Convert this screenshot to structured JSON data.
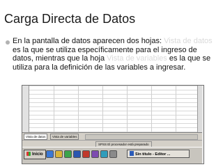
{
  "slide": {
    "title": "Carga Directa de Datos",
    "para": {
      "t1": "En la pantalla de datos aparecen dos hojas: ",
      "h1": "Vista de datos",
      "t2": " es la que se utiliza específicamente para el ingreso de datos, mientras que la hoja ",
      "h2": "Vista de variables",
      "t3": " es la que se utiliza para la definición de las variables a ingresar."
    },
    "highlight_color": "#d9d9d9"
  },
  "screenshot": {
    "tabs": [
      "Vista de datos",
      "Vista de variables"
    ],
    "status": "SPSS El procesador está preparado",
    "start_label": "Inicio",
    "taskbar_app": "Sin título - Editor ..."
  }
}
